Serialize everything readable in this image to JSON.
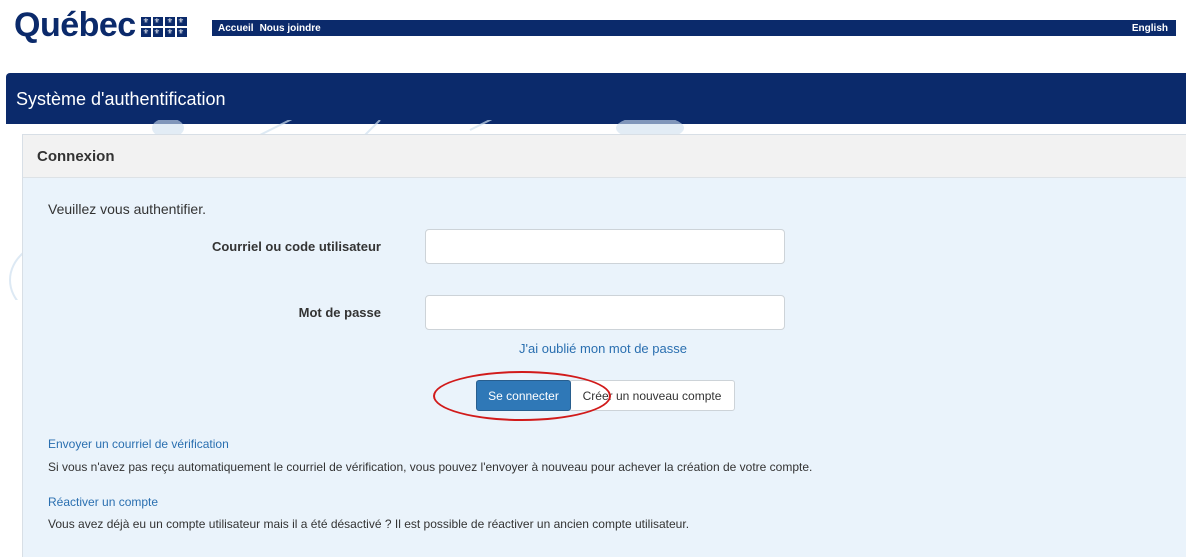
{
  "header": {
    "logo_text": "Québec",
    "nav": [
      "Accueil",
      "Nous joindre"
    ],
    "language_link": "English"
  },
  "banner": {
    "title": "Système d'authentification"
  },
  "login": {
    "heading": "Connexion",
    "intro": "Veuillez vous authentifier.",
    "username_label": "Courriel ou code utilisateur",
    "username_value": "",
    "password_label": "Mot de passe",
    "password_value": "",
    "forgot_link": "J'ai oublié mon mot de passe",
    "login_button": "Se connecter",
    "create_button": "Créer un nouveau compte"
  },
  "extra": {
    "verify_link": "Envoyer un courriel de vérification",
    "verify_desc": "Si vous n'avez pas reçu automatiquement le courriel de vérification, vous pouvez l'envoyer à nouveau pour achever la création de votre compte.",
    "reactivate_link": "Réactiver un compte",
    "reactivate_desc": "Vous avez déjà eu un compte utilisateur mais il a été désactivé ? Il est possible de réactiver un ancien compte utilisateur."
  },
  "colors": {
    "brand": "#0b2a6b",
    "primary_button": "#2f78b7",
    "highlight": "#d11a1a",
    "link": "#2a6fb0"
  }
}
